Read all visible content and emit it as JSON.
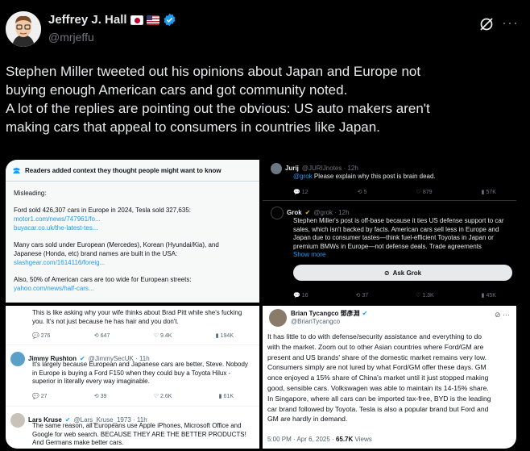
{
  "author": {
    "name": "Jeffrey J. Hall",
    "handle": "@mrjeffu",
    "flags": [
      "japan-flag",
      "usa-flag"
    ],
    "verified_icon": "verified-badge-icon"
  },
  "header_icons": {
    "grok": "grok-icon",
    "more": "···"
  },
  "post": {
    "line1": "Stephen Miller tweeted out his opinions about Japan and Europe not",
    "line2": "buying enough American cars and got community noted.",
    "line3": "A lot of the replies are pointing out the obvious: US auto makers aren't",
    "line4": "making cars that appeal to consumers in countries like Japan."
  },
  "panel1": {
    "header": "Readers added context they thought people might want to know",
    "misleading": "Misleading:",
    "p1": "Ford sold 426,307 cars in Europe in 2024, Tesla sold 327,635:",
    "l1": "motor1.com/news/747961/fo...",
    "l2": "buyacar.co.uk/the-latest-tes...",
    "p2a": "Many cars sold under European (Mercedes), Korean (Hyundai/Kia), and",
    "p2b": "Japanese (Honda, etc) brand names are built in the USA:",
    "l3": "slashgear.com/1614116/foreig...",
    "p3": "Also, 50% of American cars are too wide for European streets:",
    "l4": "yahoo.com/news/half-cars..."
  },
  "panel2": {
    "t1_name": "Jurij",
    "t1_handle": "@JURIJnotes · 12h",
    "t1_mention": "@grok",
    "t1_text": " Please explain why this post is brain dead.",
    "t1_replies": "12",
    "t1_reposts": "5",
    "t1_likes": "879",
    "t1_views": "57K",
    "t2_name": "Grok",
    "t2_handle": "@grok · 12h",
    "t2_text1": "Stephen Miller's post is off-base because it ties US defense support to car",
    "t2_text2": "sales, which isn't backed by facts. American cars sell less in Europe and",
    "t2_text3": "Japan due to consumer tastes—think fuel-efficient Toyotas in Japan or",
    "t2_text4": "premium BMWs in Europe—not defense deals. Trade agreements",
    "t2_more": "Show more",
    "ask_grok": "Ask Grok",
    "t2_replies": "16",
    "t2_reposts": "37",
    "t2_likes": "1.3K",
    "t2_views": "45K"
  },
  "panel3": {
    "t0_text1": "This is like asking why your wife thinks about Brad Pitt while she's fucking",
    "t0_text2": "you. It's not just because he has hair and you don't.",
    "t0_replies": "276",
    "t0_reposts": "647",
    "t0_likes": "9.4K",
    "t0_views": "194K",
    "t1_name": "Jimmy Rushton",
    "t1_handle": "@JimmySecUK · 11h",
    "t1_text1": "It's largely because European and Japanese cars are better, Steve. Nobody",
    "t1_text2": "in Europe is buying a Ford F150 when they could buy a Toyota Hilux -",
    "t1_text3": "superior in literally every way imaginable.",
    "t1_replies": "27",
    "t1_reposts": "39",
    "t1_likes": "2.6K",
    "t1_views": "61K",
    "t2_name": "Lars Kruse",
    "t2_handle": "@Lars_Kruse_1973 · 11h",
    "t2_text1": "The same reason, all Europeans use Apple iPhones, Microsoft Office and",
    "t2_text2": "Google for web search. BECAUSE THEY ARE THE BETTER PRODUCTS!",
    "t2_text3": "And Germans make better cars."
  },
  "panel4": {
    "name": "Brian Tycangco 鄧彥淵",
    "handle": "@BrianTycangco",
    "l1": "It has little to do with defense/security assistance and everything to do",
    "l2": "with the market. Zoom out to other Asian countries where Ford/GM are",
    "l3": "present and US brands' share of the domestic market remains very low.",
    "l4": "Consumers simply are not lured by what Ford/GM offer these days. GM",
    "l5": "once enjoyed a 15% share of China's market until it just stopped making",
    "l6": "good, sensible cars. Volkswagen was able to maintain its 14-15% share.",
    "l7": "In Singapore, where all cars can be imported tax-free, BYD is the leading",
    "l8": "car brand followed by Toyota. Tesla is also a popular brand but Ford and",
    "l9": "GM are hardly in demand.",
    "time": "5:00 PM · Apr 6, 2025 · ",
    "views": "65.7K",
    "views_label": " Views"
  }
}
